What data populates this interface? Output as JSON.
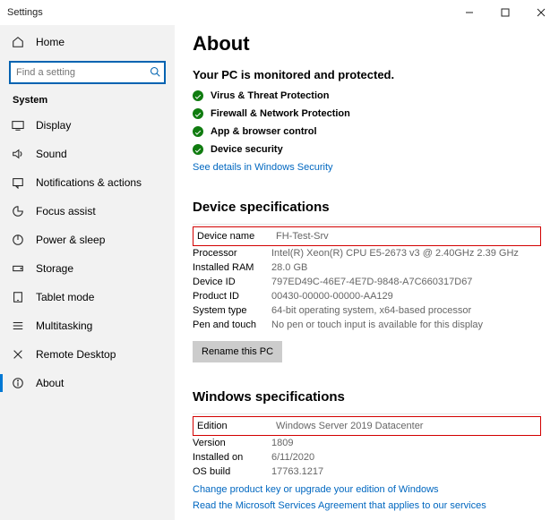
{
  "window": {
    "title": "Settings"
  },
  "sidebar": {
    "home": "Home",
    "search_placeholder": "Find a setting",
    "section": "System",
    "items": [
      {
        "label": "Display"
      },
      {
        "label": "Sound"
      },
      {
        "label": "Notifications & actions"
      },
      {
        "label": "Focus assist"
      },
      {
        "label": "Power & sleep"
      },
      {
        "label": "Storage"
      },
      {
        "label": "Tablet mode"
      },
      {
        "label": "Multitasking"
      },
      {
        "label": "Remote Desktop"
      },
      {
        "label": "About"
      }
    ]
  },
  "about": {
    "title": "About",
    "protection_heading": "Your PC is monitored and protected.",
    "protection_items": [
      "Virus & Threat Protection",
      "Firewall & Network Protection",
      "App & browser control",
      "Device security"
    ],
    "security_link": "See details in Windows Security",
    "device_spec_heading": "Device specifications",
    "device_specs": {
      "device_name_label": "Device name",
      "device_name": "FH-Test-Srv",
      "processor_label": "Processor",
      "processor": "Intel(R) Xeon(R) CPU E5-2673 v3 @ 2.40GHz   2.39 GHz",
      "ram_label": "Installed RAM",
      "ram": "28.0 GB",
      "device_id_label": "Device ID",
      "device_id": "797ED49C-46E7-4E7D-9848-A7C660317D67",
      "product_id_label": "Product ID",
      "product_id": "00430-00000-00000-AA129",
      "system_type_label": "System type",
      "system_type": "64-bit operating system, x64-based processor",
      "pen_touch_label": "Pen and touch",
      "pen_touch": "No pen or touch input is available for this display"
    },
    "rename_button": "Rename this PC",
    "windows_spec_heading": "Windows specifications",
    "windows_specs": {
      "edition_label": "Edition",
      "edition": "Windows Server 2019 Datacenter",
      "version_label": "Version",
      "version": "1809",
      "installed_on_label": "Installed on",
      "installed_on": "6/11/2020",
      "os_build_label": "OS build",
      "os_build": "17763.1217"
    },
    "upgrade_link": "Change product key or upgrade your edition of Windows",
    "services_link": "Read the Microsoft Services Agreement that applies to our services"
  }
}
